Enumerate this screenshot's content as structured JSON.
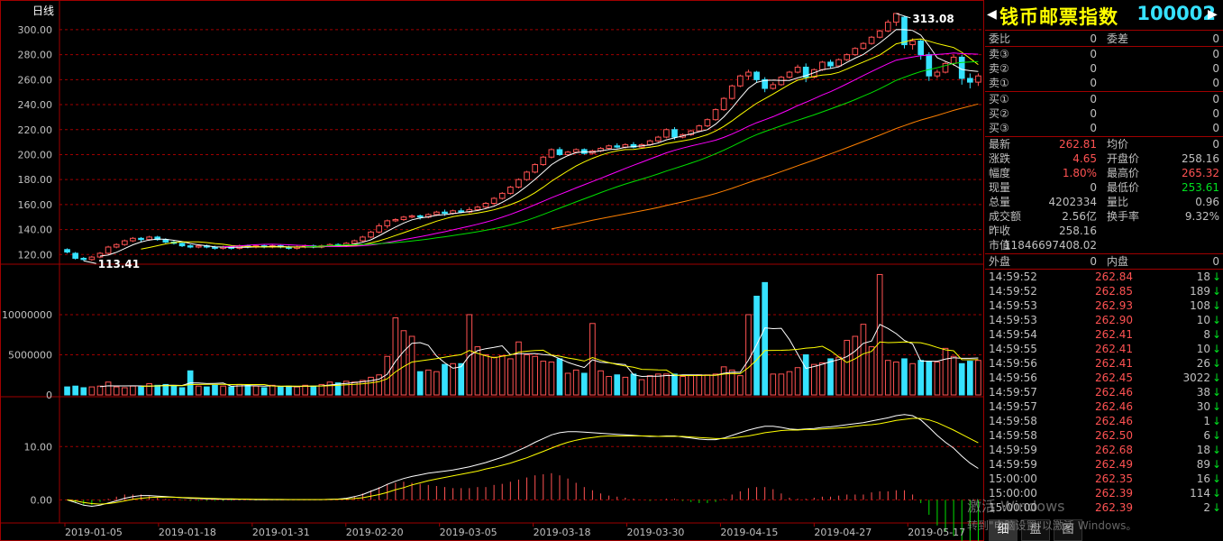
{
  "period_label": "日线",
  "high_label": "313.08",
  "low_label": "113.41",
  "colors": {
    "up": "#ff5252",
    "down": "#36e2ff",
    "grid": "#a00000",
    "ma5": "#ffffff",
    "ma10": "#ffff00",
    "ma20": "#ff00ff",
    "ma30": "#00e000",
    "ma60": "#ff8000"
  },
  "price_axis": [
    "300.00",
    "280.00",
    "260.00",
    "240.00",
    "220.00",
    "200.00",
    "180.00",
    "160.00",
    "140.00",
    "120.00"
  ],
  "vol_axis": [
    "10000000",
    "5000000",
    "0"
  ],
  "macd_axis": [
    "10.00",
    "0.00"
  ],
  "date_axis": [
    "2019-01-05",
    "2019-01-18",
    "2019-01-31",
    "2019-02-20",
    "2019-03-05",
    "2019-03-18",
    "2019-03-30",
    "2019-04-15",
    "2019-04-27",
    "2019-05-17"
  ],
  "chart_data": {
    "type": "candlestick",
    "ylim": [
      113,
      318
    ],
    "candles": [
      [
        124,
        122,
        125,
        121
      ],
      [
        121,
        117,
        122,
        116
      ],
      [
        117,
        116,
        118,
        115
      ],
      [
        116,
        118,
        119,
        115
      ],
      [
        118,
        121,
        122,
        117
      ],
      [
        121,
        126,
        127,
        120
      ],
      [
        126,
        128,
        129,
        125
      ],
      [
        128,
        131,
        132,
        127
      ],
      [
        131,
        133,
        134,
        130
      ],
      [
        133,
        132,
        134,
        130
      ],
      [
        132,
        134,
        135,
        131
      ],
      [
        134,
        132,
        135,
        131
      ],
      [
        132,
        130,
        133,
        129
      ],
      [
        130,
        129,
        131,
        128
      ],
      [
        129,
        127,
        130,
        126
      ],
      [
        127,
        126,
        128,
        125
      ],
      [
        126,
        127,
        128,
        125
      ],
      [
        127,
        126,
        128,
        125
      ],
      [
        126,
        125,
        127,
        124
      ],
      [
        125,
        126,
        127,
        124
      ],
      [
        126,
        125,
        127,
        124
      ],
      [
        125,
        127,
        128,
        124
      ],
      [
        127,
        126,
        128,
        125
      ],
      [
        126,
        127,
        128,
        125
      ],
      [
        127,
        126,
        128,
        125
      ],
      [
        126,
        127,
        128,
        125
      ],
      [
        127,
        126,
        128,
        125
      ],
      [
        126,
        125,
        127,
        124
      ],
      [
        125,
        126,
        127,
        124
      ],
      [
        126,
        127,
        128,
        125
      ],
      [
        127,
        126,
        128,
        125
      ],
      [
        126,
        127,
        128,
        125
      ],
      [
        127,
        128,
        129,
        126
      ],
      [
        128,
        127,
        129,
        126
      ],
      [
        127,
        129,
        130,
        126
      ],
      [
        129,
        131,
        132,
        128
      ],
      [
        131,
        134,
        135,
        130
      ],
      [
        134,
        138,
        139,
        133
      ],
      [
        138,
        143,
        145,
        137
      ],
      [
        143,
        147,
        148,
        141
      ],
      [
        147,
        148,
        149,
        146
      ],
      [
        148,
        150,
        151,
        147
      ],
      [
        150,
        151,
        152,
        149
      ],
      [
        151,
        150,
        152,
        148
      ],
      [
        150,
        152,
        153,
        149
      ],
      [
        152,
        154,
        155,
        151
      ],
      [
        154,
        153,
        156,
        151
      ],
      [
        153,
        155,
        156,
        152
      ],
      [
        155,
        154,
        157,
        153
      ],
      [
        154,
        156,
        158,
        153
      ],
      [
        156,
        158,
        159,
        155
      ],
      [
        158,
        161,
        162,
        157
      ],
      [
        161,
        165,
        166,
        160
      ],
      [
        165,
        169,
        170,
        164
      ],
      [
        169,
        174,
        175,
        168
      ],
      [
        174,
        180,
        181,
        173
      ],
      [
        180,
        186,
        187,
        179
      ],
      [
        186,
        192,
        193,
        185
      ],
      [
        192,
        198,
        199,
        191
      ],
      [
        198,
        204,
        205,
        197
      ],
      [
        204,
        200,
        206,
        199
      ],
      [
        200,
        202,
        203,
        199
      ],
      [
        202,
        204,
        205,
        201
      ],
      [
        204,
        201,
        205,
        200
      ],
      [
        201,
        203,
        204,
        200
      ],
      [
        203,
        205,
        206,
        202
      ],
      [
        205,
        207,
        208,
        204
      ],
      [
        207,
        206,
        209,
        205
      ],
      [
        206,
        208,
        209,
        205
      ],
      [
        208,
        206,
        210,
        205
      ],
      [
        206,
        208,
        209,
        205
      ],
      [
        208,
        211,
        212,
        207
      ],
      [
        211,
        214,
        215,
        210
      ],
      [
        214,
        220,
        221,
        213
      ],
      [
        220,
        214,
        222,
        212
      ],
      [
        214,
        216,
        217,
        213
      ],
      [
        216,
        219,
        220,
        215
      ],
      [
        219,
        223,
        224,
        218
      ],
      [
        223,
        228,
        229,
        222
      ],
      [
        228,
        236,
        237,
        227
      ],
      [
        236,
        245,
        246,
        235
      ],
      [
        245,
        255,
        256,
        244
      ],
      [
        255,
        263,
        264,
        254
      ],
      [
        263,
        266,
        268,
        260
      ],
      [
        266,
        260,
        267,
        258
      ],
      [
        260,
        253,
        262,
        250
      ],
      [
        253,
        256,
        258,
        252
      ],
      [
        256,
        262,
        263,
        255
      ],
      [
        262,
        266,
        267,
        261
      ],
      [
        266,
        270,
        272,
        265
      ],
      [
        270,
        262,
        273,
        258
      ],
      [
        262,
        268,
        269,
        261
      ],
      [
        268,
        274,
        275,
        267
      ],
      [
        274,
        271,
        276,
        269
      ],
      [
        271,
        276,
        277,
        270
      ],
      [
        276,
        280,
        281,
        275
      ],
      [
        280,
        285,
        286,
        279
      ],
      [
        285,
        289,
        290,
        284
      ],
      [
        289,
        294,
        295,
        288
      ],
      [
        294,
        299,
        300,
        293
      ],
      [
        299,
        306,
        308,
        298
      ],
      [
        306,
        313,
        313,
        303
      ],
      [
        310,
        288,
        311,
        285
      ],
      [
        288,
        291,
        293,
        284
      ],
      [
        291,
        280,
        292,
        276
      ],
      [
        280,
        263,
        282,
        259
      ],
      [
        263,
        266,
        268,
        261
      ],
      [
        266,
        273,
        275,
        265
      ],
      [
        273,
        278,
        280,
        271
      ],
      [
        278,
        261,
        280,
        256
      ],
      [
        261,
        258,
        265,
        253
      ],
      [
        258,
        263,
        265,
        255
      ]
    ],
    "volume": [
      1,
      1.1,
      0.9,
      1,
      1.1,
      1.6,
      1,
      0.9,
      1.1,
      1.0,
      1.4,
      1.2,
      1.3,
      1.1,
      0.9,
      3.0,
      1.1,
      1.0,
      1.2,
      1.1,
      1.0,
      1.3,
      1.2,
      1.1,
      0.9,
      1.2,
      1.0,
      1.1,
      1.0,
      1.2,
      1.1,
      1.3,
      1.6,
      1.5,
      1.7,
      1.6,
      1.8,
      2.2,
      2.5,
      4.8,
      9.6,
      8.0,
      7.3,
      2.9,
      3.1,
      2.9,
      3.8,
      3.9,
      3.9,
      10.0,
      6.0,
      5.0,
      4.7,
      4.9,
      4.5,
      6.6,
      5.0,
      4.8,
      4.2,
      4.1,
      4.5,
      2.7,
      3.1,
      2.7,
      8.9,
      3.0,
      2.3,
      2.5,
      2.2,
      2.6,
      1.9,
      2.4,
      2.6,
      2.6,
      2.6,
      2.3,
      2.4,
      2.5,
      2.5,
      2.6,
      3.5,
      3.1,
      2.4,
      10.0,
      12.3,
      14.0,
      2.6,
      2.6,
      2.9,
      3.4,
      5.0,
      3.8,
      4.0,
      4.5,
      4.7,
      6.8,
      7.3,
      8.8,
      6.0,
      15.0,
      4.3,
      4.1,
      4.5,
      3.9,
      4.3,
      4.2,
      4.1,
      5.8,
      4.8,
      3.9,
      4.2,
      4.3
    ],
    "macd_dif": [
      0,
      -0.5,
      -1,
      -1.2,
      -1,
      -0.6,
      -0.2,
      0.3,
      0.6,
      0.8,
      0.8,
      0.7,
      0.6,
      0.5,
      0.4,
      0.3,
      0.25,
      0.2,
      0.15,
      0.1,
      0.1,
      0.1,
      0.1,
      0.05,
      0.05,
      0.05,
      0.05,
      0.05,
      0.05,
      0.05,
      0.05,
      0.05,
      0.1,
      0.15,
      0.3,
      0.6,
      1.0,
      1.6,
      2.2,
      2.9,
      3.5,
      4.0,
      4.4,
      4.7,
      5.0,
      5.2,
      5.4,
      5.6,
      5.9,
      6.2,
      6.6,
      7.0,
      7.5,
      8.0,
      8.6,
      9.3,
      10.0,
      10.8,
      11.5,
      12.2,
      12.6,
      12.8,
      12.8,
      12.7,
      12.6,
      12.5,
      12.4,
      12.3,
      12.2,
      12.1,
      12.0,
      11.9,
      11.9,
      12.0,
      12.0,
      11.8,
      11.6,
      11.4,
      11.3,
      11.3,
      11.6,
      12.1,
      12.6,
      13.1,
      13.5,
      13.8,
      13.8,
      13.6,
      13.3,
      13.2,
      13.3,
      13.4,
      13.6,
      13.7,
      13.9,
      14.1,
      14.3,
      14.5,
      14.8,
      15.1,
      15.4,
      15.8,
      16.0,
      15.8,
      15.0,
      13.6,
      12.1,
      10.8,
      9.7,
      8.2,
      6.9,
      5.9
    ],
    "macd_dea": [
      0,
      -0.2,
      -0.5,
      -0.7,
      -0.8,
      -0.7,
      -0.5,
      -0.2,
      0.1,
      0.3,
      0.45,
      0.5,
      0.5,
      0.5,
      0.45,
      0.4,
      0.35,
      0.3,
      0.25,
      0.2,
      0.18,
      0.15,
      0.13,
      0.1,
      0.1,
      0.08,
      0.08,
      0.07,
      0.07,
      0.07,
      0.07,
      0.07,
      0.08,
      0.1,
      0.15,
      0.25,
      0.4,
      0.7,
      1.0,
      1.4,
      1.9,
      2.3,
      2.8,
      3.2,
      3.6,
      3.9,
      4.2,
      4.5,
      4.8,
      5.1,
      5.4,
      5.8,
      6.1,
      6.5,
      6.9,
      7.4,
      7.9,
      8.5,
      9.1,
      9.7,
      10.3,
      10.8,
      11.2,
      11.5,
      11.7,
      11.9,
      12.0,
      12.0,
      12.0,
      12.0,
      12.0,
      12.0,
      11.9,
      11.9,
      11.9,
      11.9,
      11.8,
      11.7,
      11.6,
      11.5,
      11.5,
      11.6,
      11.8,
      12.0,
      12.3,
      12.6,
      12.8,
      13.0,
      13.1,
      13.1,
      13.2,
      13.2,
      13.3,
      13.4,
      13.5,
      13.6,
      13.8,
      14.0,
      14.1,
      14.3,
      14.6,
      14.9,
      15.1,
      15.3,
      15.3,
      15.0,
      14.5,
      13.8,
      13.1,
      12.3,
      11.5,
      10.7
    ]
  },
  "panel": {
    "title": "钱币邮票指数",
    "code": "100002",
    "rows1": [
      {
        "l": "委比",
        "v": "0",
        "l2": "委差",
        "v2": "0"
      }
    ],
    "sells": [
      {
        "l": "卖③",
        "v": "0",
        "v2": "0"
      },
      {
        "l": "卖②",
        "v": "0",
        "v2": "0"
      },
      {
        "l": "卖①",
        "v": "0",
        "v2": "0"
      }
    ],
    "buys": [
      {
        "l": "买①",
        "v": "0",
        "v2": "0"
      },
      {
        "l": "买②",
        "v": "0",
        "v2": "0"
      },
      {
        "l": "买③",
        "v": "0",
        "v2": "0"
      }
    ],
    "quote": [
      {
        "l": "最新",
        "v": "262.81",
        "vc": "#ff5252",
        "l2": "均价",
        "v2": "0",
        "v2c": "#c0c0c0"
      },
      {
        "l": "涨跌",
        "v": "4.65",
        "vc": "#ff5252",
        "l2": "开盘价",
        "v2": "258.16",
        "v2c": "#c0c0c0"
      },
      {
        "l": "幅度",
        "v": "1.80%",
        "vc": "#ff5252",
        "l2": "最高价",
        "v2": "265.32",
        "v2c": "#ff5252"
      },
      {
        "l": "现量",
        "v": "0",
        "vc": "#c0c0c0",
        "l2": "最低价",
        "v2": "253.61",
        "v2c": "#00e020"
      },
      {
        "l": "总量",
        "v": "4202334",
        "vc": "#c0c0c0",
        "l2": "量比",
        "v2": "0.96",
        "v2c": "#c0c0c0"
      },
      {
        "l": "成交额",
        "v": "2.56亿",
        "vc": "#c0c0c0",
        "l2": "换手率",
        "v2": "9.32%",
        "v2c": "#c0c0c0"
      },
      {
        "l": "昨收",
        "v": "258.16",
        "vc": "#c0c0c0",
        "l2": "",
        "v2": "",
        "v2c": "#c0c0c0"
      },
      {
        "l": "市值",
        "v": "11846697408.02",
        "vc": "#c0c0c0",
        "l2": "",
        "v2": "",
        "v2c": "#c0c0c0"
      }
    ],
    "outer": {
      "l": "外盘",
      "v": "0",
      "l2": "内盘",
      "v2": "0"
    },
    "ticks": [
      {
        "t": "14:59:52",
        "p": "262.84",
        "v": "18"
      },
      {
        "t": "14:59:52",
        "p": "262.85",
        "v": "189"
      },
      {
        "t": "14:59:53",
        "p": "262.93",
        "v": "108"
      },
      {
        "t": "14:59:53",
        "p": "262.90",
        "v": "10"
      },
      {
        "t": "14:59:54",
        "p": "262.41",
        "v": "8"
      },
      {
        "t": "14:59:55",
        "p": "262.41",
        "v": "10"
      },
      {
        "t": "14:59:56",
        "p": "262.41",
        "v": "26"
      },
      {
        "t": "14:59:56",
        "p": "262.45",
        "v": "3022"
      },
      {
        "t": "14:59:57",
        "p": "262.46",
        "v": "38"
      },
      {
        "t": "14:59:57",
        "p": "262.46",
        "v": "30"
      },
      {
        "t": "14:59:58",
        "p": "262.46",
        "v": "1"
      },
      {
        "t": "14:59:58",
        "p": "262.50",
        "v": "6"
      },
      {
        "t": "14:59:59",
        "p": "262.68",
        "v": "18"
      },
      {
        "t": "14:59:59",
        "p": "262.49",
        "v": "89"
      },
      {
        "t": "15:00:00",
        "p": "262.35",
        "v": "16"
      },
      {
        "t": "15:00:00",
        "p": "262.39",
        "v": "114"
      },
      {
        "t": "15:00:00",
        "p": "262.39",
        "v": "2"
      }
    ],
    "tick_arrow": "↓",
    "tabs": [
      "细",
      "盘",
      "图"
    ]
  },
  "watermark": {
    "line1": "激活 Windows",
    "line2": "转到\"电脑设置\"以激活 Windows。"
  }
}
